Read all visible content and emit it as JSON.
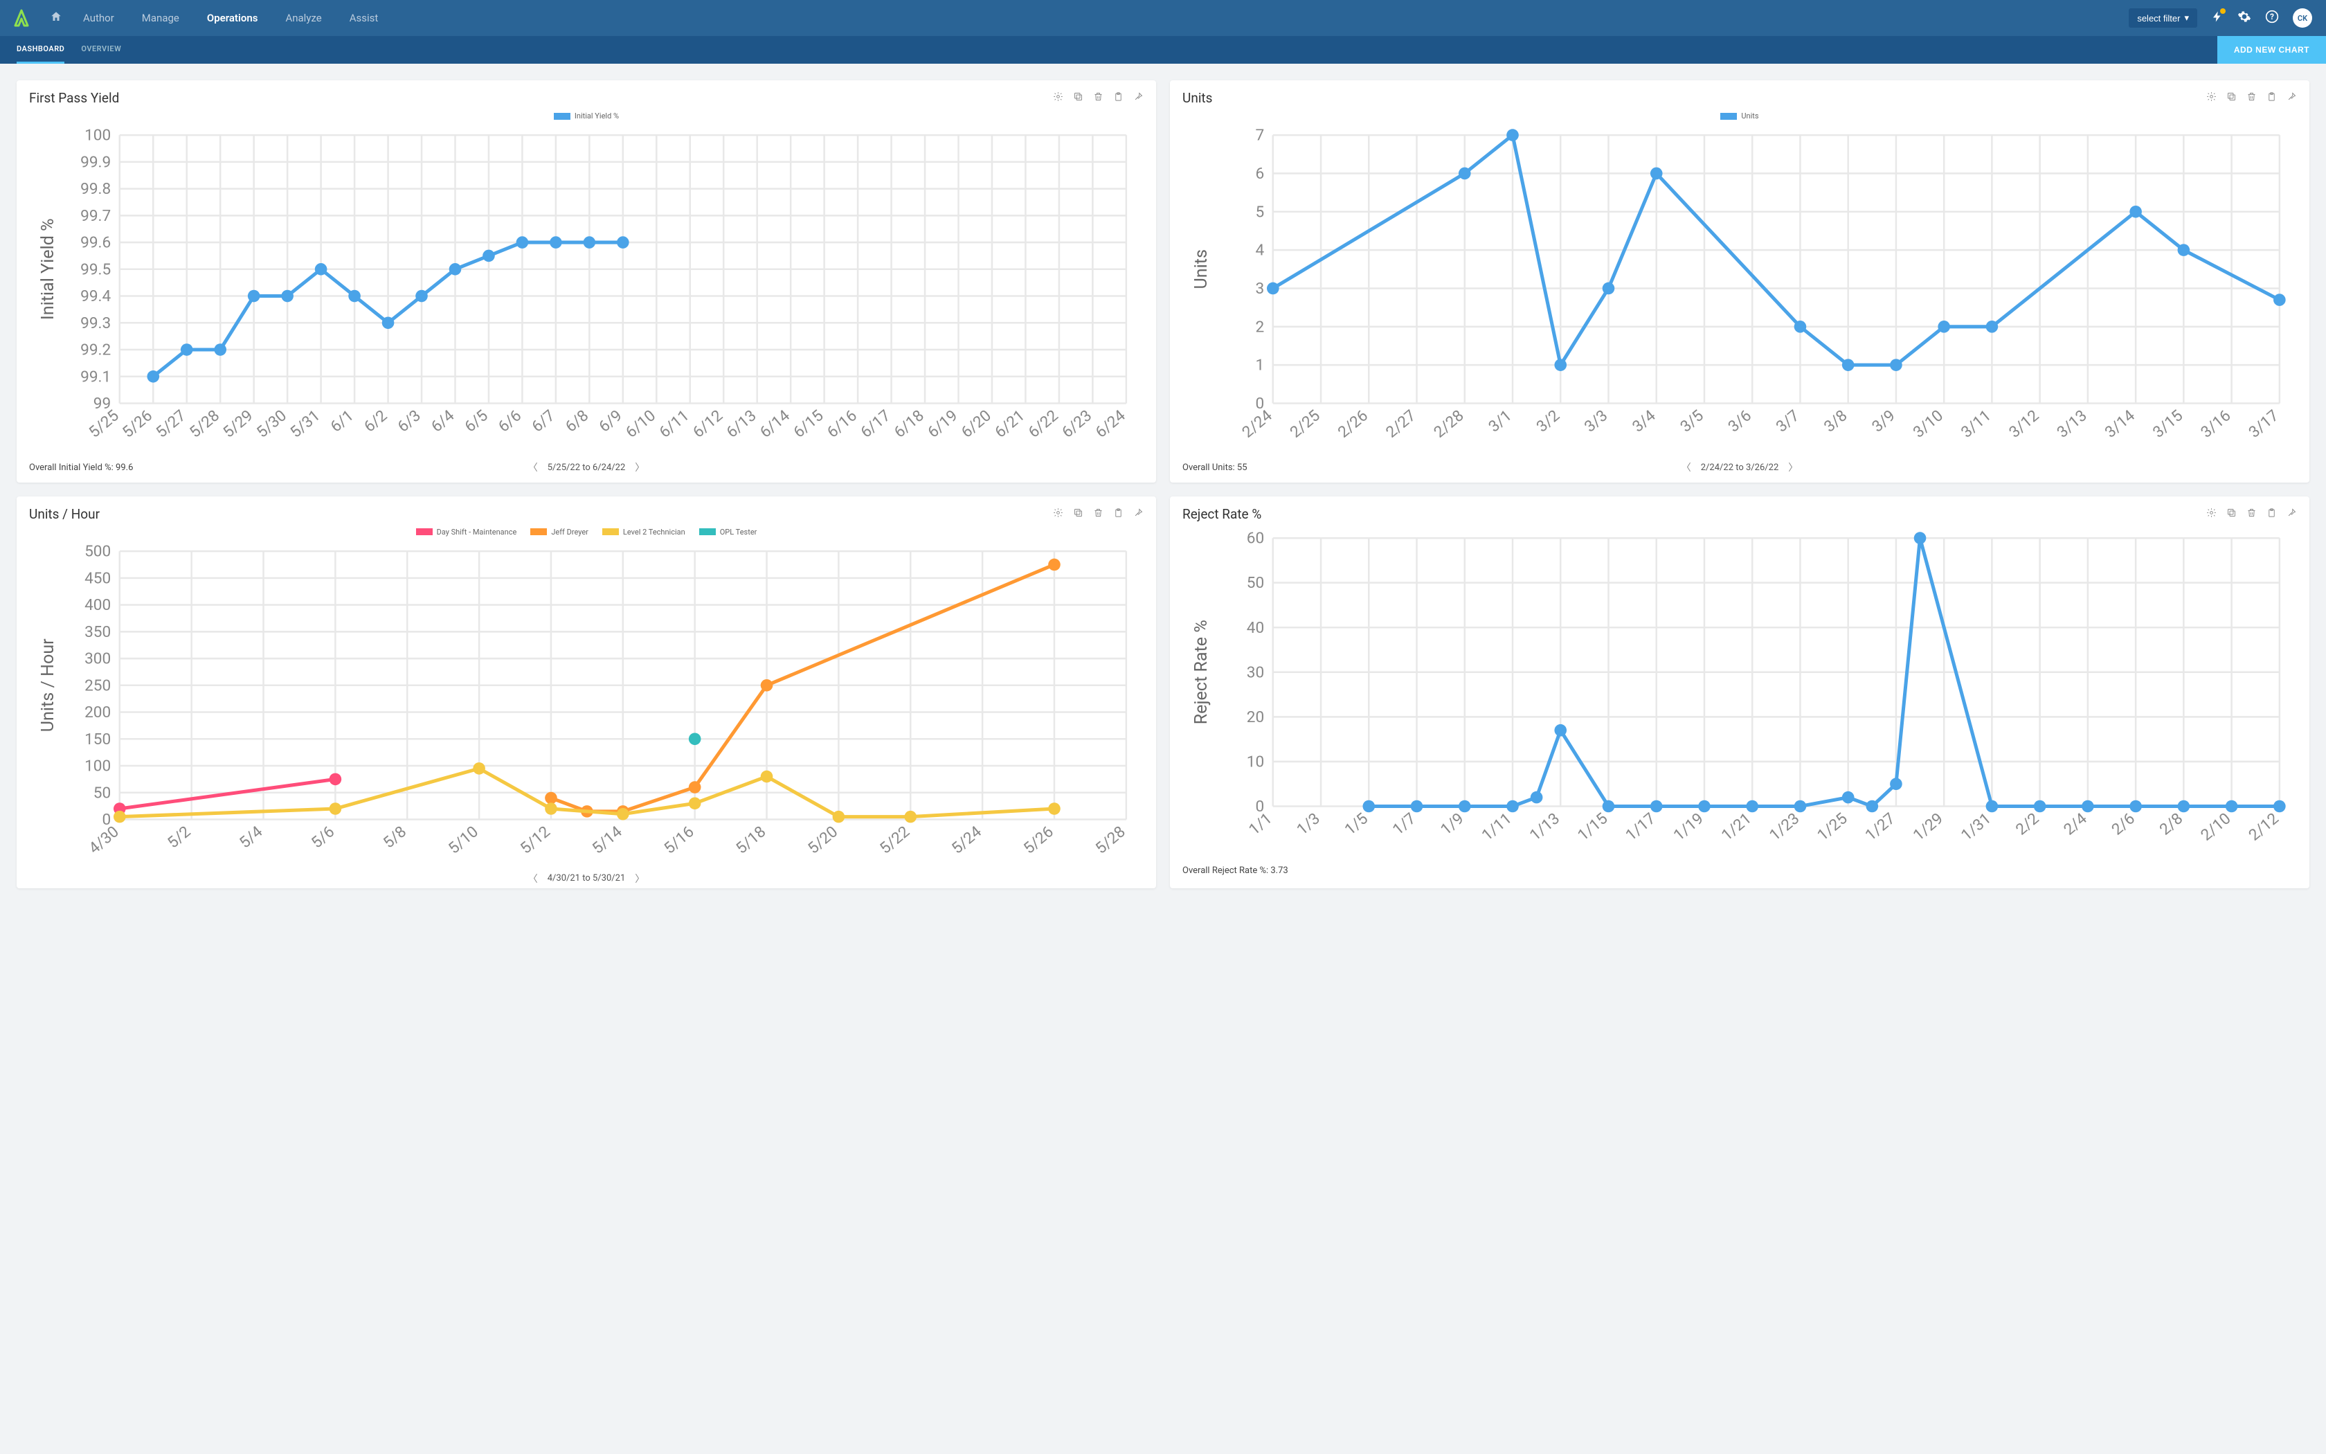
{
  "header": {
    "nav": [
      "Author",
      "Manage",
      "Operations",
      "Analyze",
      "Assist"
    ],
    "active_nav": "Operations",
    "filter_label": "select filter",
    "avatar": "CK"
  },
  "subnav": {
    "tabs": [
      "DASHBOARD",
      "OVERVIEW"
    ],
    "active_tab": "DASHBOARD",
    "add_label": "ADD NEW CHART"
  },
  "cards": [
    {
      "title": "First Pass Yield",
      "legend": [
        {
          "label": "Initial Yield %",
          "color": "#4aa3e8"
        }
      ],
      "summary": "Overall Initial Yield %: 99.6",
      "date_range": "5/25/22 to 6/24/22"
    },
    {
      "title": "Units",
      "legend": [
        {
          "label": "Units",
          "color": "#4aa3e8"
        }
      ],
      "summary": "Overall Units: 55",
      "date_range": "2/24/22 to 3/26/22"
    },
    {
      "title": "Units / Hour",
      "legend": [
        {
          "label": "Day Shift - Maintenance",
          "color": "#ff4d7a"
        },
        {
          "label": "Jeff Dreyer",
          "color": "#ff9933"
        },
        {
          "label": "Level 2 Technician",
          "color": "#f5c842"
        },
        {
          "label": "OPL Tester",
          "color": "#33bdbd"
        }
      ],
      "summary": "",
      "date_range": "4/30/21 to 5/30/21"
    },
    {
      "title": "Reject Rate %",
      "legend": [],
      "summary": "Overall Reject Rate %: 3.73",
      "date_range": ""
    }
  ],
  "chart_data": [
    {
      "type": "line",
      "title": "First Pass Yield",
      "ylabel": "Initial Yield %",
      "ylim": [
        99.0,
        100.0
      ],
      "yticks": [
        99.0,
        99.1,
        99.2,
        99.3,
        99.4,
        99.5,
        99.6,
        99.7,
        99.8,
        99.9,
        100.0
      ],
      "x_all": [
        "5/25",
        "5/26",
        "5/27",
        "5/28",
        "5/29",
        "5/30",
        "5/31",
        "6/1",
        "6/2",
        "6/3",
        "6/4",
        "6/5",
        "6/6",
        "6/7",
        "6/8",
        "6/9",
        "6/10",
        "6/11",
        "6/12",
        "6/13",
        "6/14",
        "6/15",
        "6/16",
        "6/17",
        "6/18",
        "6/19",
        "6/20",
        "6/21",
        "6/22",
        "6/23",
        "6/24"
      ],
      "series": [
        {
          "name": "Initial Yield %",
          "color": "#4aa3e8",
          "points": [
            {
              "x": "5/26",
              "y": 99.1
            },
            {
              "x": "5/27",
              "y": 99.2
            },
            {
              "x": "5/28",
              "y": 99.2
            },
            {
              "x": "5/29",
              "y": 99.4
            },
            {
              "x": "5/30",
              "y": 99.4
            },
            {
              "x": "5/31",
              "y": 99.5
            },
            {
              "x": "6/1",
              "y": 99.4
            },
            {
              "x": "6/2",
              "y": 99.3
            },
            {
              "x": "6/3",
              "y": 99.4
            },
            {
              "x": "6/4",
              "y": 99.5
            },
            {
              "x": "6/5",
              "y": 99.55
            },
            {
              "x": "6/6",
              "y": 99.6
            },
            {
              "x": "6/7",
              "y": 99.6
            },
            {
              "x": "6/8",
              "y": 99.6
            },
            {
              "x": "6/9",
              "y": 99.6
            }
          ]
        }
      ]
    },
    {
      "type": "line",
      "title": "Units",
      "ylabel": "Units",
      "ylim": [
        0,
        7
      ],
      "yticks": [
        0,
        1,
        2,
        3,
        4,
        5,
        6,
        7
      ],
      "x_all": [
        "2/24",
        "2/25",
        "2/26",
        "2/27",
        "2/28",
        "3/1",
        "3/2",
        "3/3",
        "3/4",
        "3/5",
        "3/6",
        "3/7",
        "3/8",
        "3/9",
        "3/10",
        "3/11",
        "3/12",
        "3/13",
        "3/14",
        "3/15",
        "3/16",
        "3/17"
      ],
      "series": [
        {
          "name": "Units",
          "color": "#4aa3e8",
          "points": [
            {
              "x": "2/24",
              "y": 3
            },
            {
              "x": "2/28",
              "y": 6
            },
            {
              "x": "3/1",
              "y": 7
            },
            {
              "x": "3/2",
              "y": 1
            },
            {
              "x": "3/3",
              "y": 3
            },
            {
              "x": "3/4",
              "y": 6
            },
            {
              "x": "3/7",
              "y": 2
            },
            {
              "x": "3/8",
              "y": 1
            },
            {
              "x": "3/9",
              "y": 1
            },
            {
              "x": "3/10",
              "y": 2
            },
            {
              "x": "3/11",
              "y": 2
            },
            {
              "x": "3/14",
              "y": 5
            },
            {
              "x": "3/15",
              "y": 4
            },
            {
              "x": "3/17",
              "y": 2.7
            }
          ]
        }
      ]
    },
    {
      "type": "line",
      "title": "Units / Hour",
      "ylabel": "Units / Hour",
      "ylim": [
        0,
        500
      ],
      "yticks": [
        0,
        50,
        100,
        150,
        200,
        250,
        300,
        350,
        400,
        450,
        500
      ],
      "x_all": [
        "4/30",
        "5/2",
        "5/4",
        "5/6",
        "5/8",
        "5/10",
        "5/12",
        "5/14",
        "5/16",
        "5/18",
        "5/20",
        "5/22",
        "5/24",
        "5/26",
        "5/28"
      ],
      "series": [
        {
          "name": "Day Shift - Maintenance",
          "color": "#ff4d7a",
          "points": [
            {
              "x": "4/30",
              "y": 20
            },
            {
              "x": "5/6",
              "y": 75
            }
          ]
        },
        {
          "name": "Jeff Dreyer",
          "color": "#ff9933",
          "points": [
            {
              "x": "5/12",
              "y": 40
            },
            {
              "x": "5/13",
              "y": 15
            },
            {
              "x": "5/14",
              "y": 15
            },
            {
              "x": "5/16",
              "y": 60
            },
            {
              "x": "5/18",
              "y": 250
            },
            {
              "x": "5/26",
              "y": 475
            }
          ]
        },
        {
          "name": "Level 2 Technician",
          "color": "#f5c842",
          "points": [
            {
              "x": "4/30",
              "y": 5
            },
            {
              "x": "5/6",
              "y": 20
            },
            {
              "x": "5/10",
              "y": 95
            },
            {
              "x": "5/12",
              "y": 20
            },
            {
              "x": "5/14",
              "y": 10
            },
            {
              "x": "5/16",
              "y": 30
            },
            {
              "x": "5/18",
              "y": 80
            },
            {
              "x": "5/20",
              "y": 5
            },
            {
              "x": "5/22",
              "y": 5
            },
            {
              "x": "5/26",
              "y": 20
            }
          ]
        },
        {
          "name": "OPL Tester",
          "color": "#33bdbd",
          "points": [
            {
              "x": "5/16",
              "y": 150
            }
          ]
        }
      ]
    },
    {
      "type": "line",
      "title": "Reject Rate %",
      "ylabel": "Reject Rate %",
      "ylim": [
        0,
        60
      ],
      "yticks": [
        0,
        10,
        20,
        30,
        40,
        50,
        60
      ],
      "x_all": [
        "1/1",
        "1/3",
        "1/5",
        "1/7",
        "1/9",
        "1/11",
        "1/13",
        "1/15",
        "1/17",
        "1/19",
        "1/21",
        "1/23",
        "1/25",
        "1/27",
        "1/29",
        "1/31",
        "2/2",
        "2/4",
        "2/6",
        "2/8",
        "2/10",
        "2/12"
      ],
      "series": [
        {
          "name": "Reject Rate %",
          "color": "#4aa3e8",
          "points": [
            {
              "x": "1/5",
              "y": 0
            },
            {
              "x": "1/7",
              "y": 0
            },
            {
              "x": "1/9",
              "y": 0
            },
            {
              "x": "1/11",
              "y": 0
            },
            {
              "x": "1/12",
              "y": 2
            },
            {
              "x": "1/13",
              "y": 17
            },
            {
              "x": "1/15",
              "y": 0
            },
            {
              "x": "1/17",
              "y": 0
            },
            {
              "x": "1/19",
              "y": 0
            },
            {
              "x": "1/21",
              "y": 0
            },
            {
              "x": "1/23",
              "y": 0
            },
            {
              "x": "1/25",
              "y": 2
            },
            {
              "x": "1/26",
              "y": 0
            },
            {
              "x": "1/27",
              "y": 5
            },
            {
              "x": "1/28",
              "y": 60
            },
            {
              "x": "1/31",
              "y": 0
            },
            {
              "x": "2/2",
              "y": 0
            },
            {
              "x": "2/4",
              "y": 0
            },
            {
              "x": "2/6",
              "y": 0
            },
            {
              "x": "2/8",
              "y": 0
            },
            {
              "x": "2/10",
              "y": 0
            },
            {
              "x": "2/12",
              "y": 0
            }
          ]
        }
      ]
    }
  ]
}
